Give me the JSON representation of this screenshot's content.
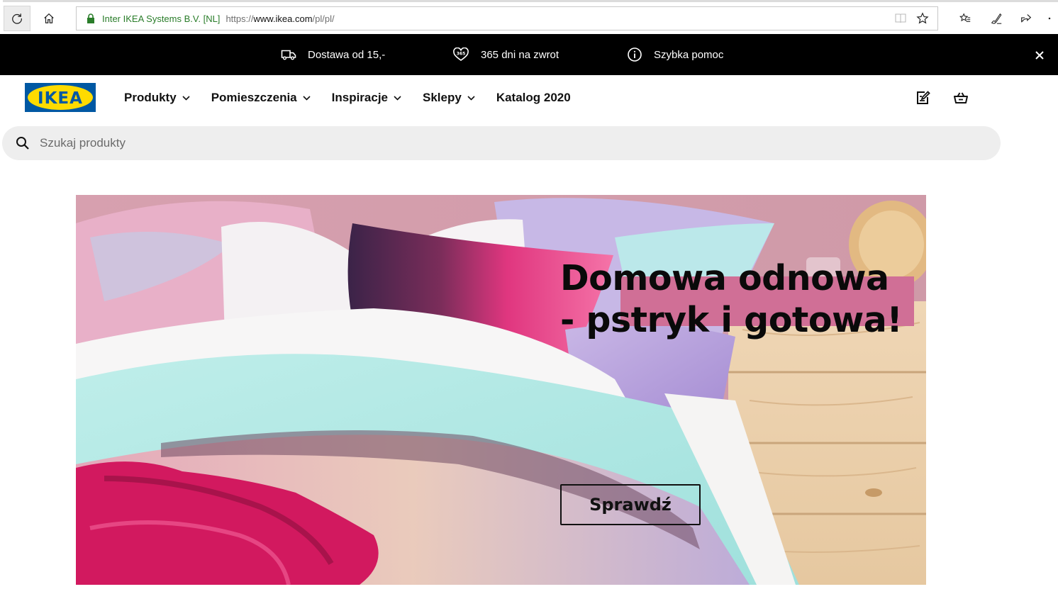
{
  "browser": {
    "site_identity": "Inter IKEA Systems B.V. [NL]",
    "url_scheme": "https://",
    "url_host": "www.ikea.com",
    "url_path": "/pl/pl/"
  },
  "infobar": {
    "delivery": "Dostawa od 15,-",
    "returns": "365 dni na zwrot",
    "help": "Szybka pomoc"
  },
  "nav": {
    "items": [
      {
        "label": "Produkty"
      },
      {
        "label": "Pomieszczenia"
      },
      {
        "label": "Inspiracje"
      },
      {
        "label": "Sklepy"
      },
      {
        "label": "Katalog 2020"
      }
    ]
  },
  "logo": {
    "text": "IKEA"
  },
  "search": {
    "placeholder": "Szukaj produkty"
  },
  "hero": {
    "title_line1": "Domowa odnowa",
    "title_line2": "- pstryk i gotowa!",
    "cta_label": "Sprawdź"
  },
  "colors": {
    "ikea_blue": "#0058a3",
    "ikea_yellow": "#ffdb00",
    "infobar_bg": "#000000",
    "search_bg": "#eeeeee",
    "title_highlight": "#d06f96"
  },
  "icons": [
    "refresh-icon",
    "home-icon",
    "lock-icon",
    "reading-view-icon",
    "favorite-star-icon",
    "hub-icon",
    "notes-icon",
    "share-icon",
    "more-icon",
    "truck-icon",
    "heart-365-icon",
    "info-icon",
    "close-icon",
    "chevron-down-icon",
    "shopping-list-icon",
    "shopping-basket-icon",
    "search-icon"
  ]
}
